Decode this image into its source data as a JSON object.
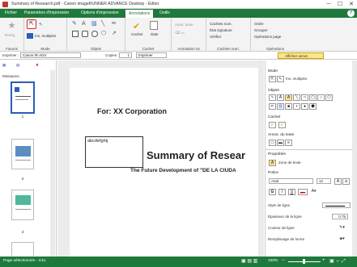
{
  "window": {
    "title": "Summary of Research.pdf - Canon imageRUNNER ADVANCE Desktop - Editor",
    "minimize": "─",
    "maximize": "☐",
    "close": "✕"
  },
  "tabs": [
    "Fichier",
    "Paramètres d'impression",
    "Options d'impression",
    "Annotations",
    "Outils"
  ],
  "active_tab": "Annotations",
  "help": "?",
  "ribbon": {
    "favoris": {
      "btn": "Enreg.",
      "label": "Favoris"
    },
    "mode": {
      "ins_multiples": "Ins. multiples",
      "label": "Mode"
    },
    "objets": {
      "label": "Objets"
    },
    "cachet": {
      "cachet": "Cachet",
      "date": "Date",
      "label": "Cachet"
    },
    "annotation_txt": {
      "ajout_texte": "Ajout. texte",
      "label": "Annotation txt"
    },
    "cachets_num": {
      "cachets_num": "Cachets num.",
      "etat_signature": "État signature",
      "verifier": "Vérifier",
      "label": "Cachets num."
    },
    "operations": {
      "ordre": "Ordre",
      "grouper": "Grouper",
      "operations_page": "Opérations page",
      "label": "Opérations"
    }
  },
  "toolbar2": {
    "imprimer_label": "Imprimer :",
    "printer": "Canon iR-ADV",
    "copies_label": "Copies :",
    "copies": "1",
    "imprimer_btn": "Imprimer",
    "afficher": "Afficher annot."
  },
  "thumbnails": {
    "title": "Miniatures",
    "pages": [
      "1",
      "2",
      "3"
    ]
  },
  "document": {
    "company": "For: XX Corporation",
    "textbox": "abcdefghij",
    "heading": "Summary of Resear",
    "subheading": "The Future Development of \"DE LA CIUDA"
  },
  "rightpanel": {
    "mode": "Mode",
    "ins_multiples": "Ins. multiples",
    "objets": "Objets",
    "cachet": "Cachet",
    "annot_texte": "Annot. du texte",
    "proprietes": "Propriétés",
    "zone_texte": "Zone de texte",
    "police": "Police",
    "font": "Arial",
    "size": "12",
    "bold": "G",
    "italic": "I",
    "underline": "S",
    "strike": "abc",
    "style_ligne": "Style de ligne",
    "epaisseur": "Épaisseur de la ligne",
    "epaisseur_val": "0.75",
    "couleur_ligne": "Couleur de ligne",
    "remplissage": "Remplissage de forme"
  },
  "status": {
    "page": "Page sélectionnée : 1/11",
    "zoom": "100%"
  },
  "colors": {
    "brand": "#1e7a3c",
    "highlight": "#e02020",
    "accent": "#2b5fb3"
  }
}
